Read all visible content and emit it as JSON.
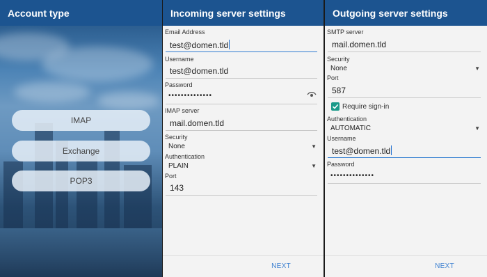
{
  "account_type": {
    "title": "Account type",
    "options": [
      "IMAP",
      "Exchange",
      "POP3"
    ]
  },
  "incoming": {
    "title": "Incoming server settings",
    "email_label": "Email Address",
    "email_value": "test@domen.tld",
    "username_label": "Username",
    "username_value": "test@domen.tld",
    "password_label": "Password",
    "password_value": "••••••••••••••",
    "server_label": "IMAP server",
    "server_value": "mail.domen.tld",
    "security_label": "Security",
    "security_value": "None",
    "auth_label": "Authentication",
    "auth_value": "PLAIN",
    "port_label": "Port",
    "port_value": "143",
    "next_label": "NEXT"
  },
  "outgoing": {
    "title": "Outgoing server settings",
    "server_label": "SMTP server",
    "server_value": "mail.domen.tld",
    "security_label": "Security",
    "security_value": "None",
    "port_label": "Port",
    "port_value": "587",
    "require_signin_label": "Require sign-in",
    "require_signin_checked": true,
    "auth_label": "Authentication",
    "auth_value": "AUTOMATIC",
    "username_label": "Username",
    "username_value": "test@domen.tld",
    "password_label": "Password",
    "password_value": "••••••••••••••",
    "next_label": "NEXT"
  },
  "icons": {
    "dropdown": "chevron-down-icon",
    "password_visibility": "eye-icon",
    "checkbox": "check-icon"
  },
  "colors": {
    "app_bar": "#1c5490",
    "focus_underline": "#2e7bd0",
    "checkbox": "#1a9a8a",
    "next_link": "#3a7fd0"
  }
}
